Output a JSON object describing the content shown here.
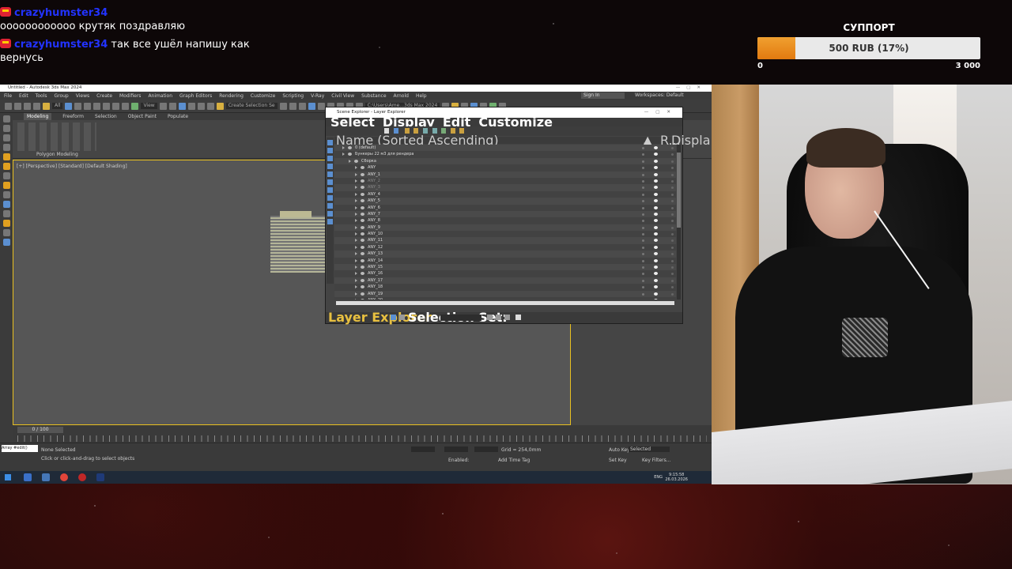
{
  "chat": {
    "messages": [
      {
        "user": "crazyhumster34",
        "text": "оооооооооооо крутяк поздравляю"
      },
      {
        "user": "crazyhumster34",
        "text": "так все ушёл напишу как вернусь"
      }
    ]
  },
  "support": {
    "title": "СУППОРТ",
    "progress_text": "500 RUB (17%)",
    "progress_fraction": 0.17,
    "min": "0",
    "max": "3 000",
    "fill_color": "#e88a1a"
  },
  "app": {
    "title": "Untitled - Autodesk 3ds Max 2024",
    "menu": [
      "File",
      "Edit",
      "Tools",
      "Group",
      "Views",
      "Create",
      "Modifiers",
      "Animation",
      "Graph Editors",
      "Rendering",
      "Customize",
      "Scripting",
      "V-Ray",
      "Civil View",
      "Substance",
      "Arnold",
      "Help"
    ],
    "sign_in": "Sign In",
    "workspaces": "Workspaces: Default",
    "toolbar_fields": {
      "filter": "All",
      "view": "View",
      "selection_set": "Create Selection Se",
      "path": "C:\\Users\\Ame...3ds Max 2024"
    },
    "ribbon_tabs": [
      "Modeling",
      "Freeform",
      "Selection",
      "Object Paint",
      "Populate"
    ],
    "polygon_modeling": "Polygon Modeling",
    "viewport_label": "[+] [Perspective] [Standard] [Default Shading]",
    "timeline_slider": "0 / 100",
    "status": {
      "maxscript": "Array #edit()",
      "line1": "None Selected",
      "line2": "Click or click-and-drag to select objects",
      "grid": "Grid = 254,0mm",
      "enabled": "Enabled:",
      "add_time_tag": "Add Time Tag",
      "auto_key": "Auto Key",
      "set_key": "Set Key",
      "selected": "Selected",
      "key_filters": "Key Filters..."
    },
    "taskbar": {
      "lang": "ENG",
      "time": "9:15:58",
      "date": "26.03.2026"
    }
  },
  "scene_explorer": {
    "title": "Scene Explorer - Layer Explorer",
    "menu": [
      "Select",
      "Display",
      "Edit",
      "Customize"
    ],
    "col_name": "Name (Sorted Ascending)",
    "col_fr": "▲ Fr...",
    "col_r": "R...",
    "col_disp": "Displa...",
    "rows": [
      {
        "name": "0 (default)",
        "level": 0
      },
      {
        "name": "Бункеры 22 м3 для рендера",
        "level": 0
      },
      {
        "name": "Сборка",
        "level": 1
      },
      {
        "name": "ANY",
        "level": 2
      },
      {
        "name": "ANY_1",
        "level": 2
      },
      {
        "name": "ANY_2",
        "level": 2,
        "dim": true
      },
      {
        "name": "ANY_3",
        "level": 2,
        "dim": true
      },
      {
        "name": "ANY_4",
        "level": 2
      },
      {
        "name": "ANY_5",
        "level": 2
      },
      {
        "name": "ANY_6",
        "level": 2
      },
      {
        "name": "ANY_7",
        "level": 2
      },
      {
        "name": "ANY_8",
        "level": 2
      },
      {
        "name": "ANY_9",
        "level": 2
      },
      {
        "name": "ANY_10",
        "level": 2
      },
      {
        "name": "ANY_11",
        "level": 2
      },
      {
        "name": "ANY_12",
        "level": 2
      },
      {
        "name": "ANY_13",
        "level": 2
      },
      {
        "name": "ANY_14",
        "level": 2
      },
      {
        "name": "ANY_15",
        "level": 2
      },
      {
        "name": "ANY_16",
        "level": 2
      },
      {
        "name": "ANY_17",
        "level": 2
      },
      {
        "name": "ANY_18",
        "level": 2
      },
      {
        "name": "ANY_19",
        "level": 2
      },
      {
        "name": "ANY_20",
        "level": 2
      }
    ],
    "footer": {
      "explorer": "Layer Explorer",
      "selection_set": "Selection Set:"
    }
  }
}
